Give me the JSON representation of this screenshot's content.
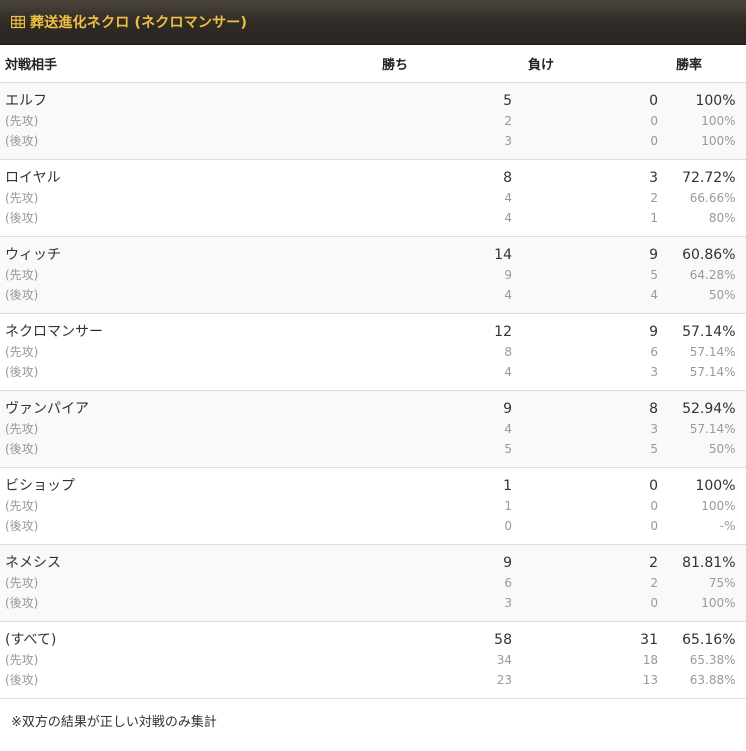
{
  "header": {
    "title": "葬送進化ネクロ (ネクロマンサー)",
    "icon": "table-grid-icon",
    "title_color": "#f0c040"
  },
  "columns": {
    "opponent": "対戦相手",
    "wins": "勝ち",
    "losses": "負け",
    "rate": "勝率"
  },
  "rows": [
    {
      "opponent": "エルフ",
      "wins": "5",
      "losses": "0",
      "rate": "100%",
      "first": {
        "label": "(先攻)",
        "wins": "2",
        "losses": "0",
        "rate": "100%"
      },
      "second": {
        "label": "(後攻)",
        "wins": "3",
        "losses": "0",
        "rate": "100%"
      }
    },
    {
      "opponent": "ロイヤル",
      "wins": "8",
      "losses": "3",
      "rate": "72.72%",
      "first": {
        "label": "(先攻)",
        "wins": "4",
        "losses": "2",
        "rate": "66.66%"
      },
      "second": {
        "label": "(後攻)",
        "wins": "4",
        "losses": "1",
        "rate": "80%"
      }
    },
    {
      "opponent": "ウィッチ",
      "wins": "14",
      "losses": "9",
      "rate": "60.86%",
      "first": {
        "label": "(先攻)",
        "wins": "9",
        "losses": "5",
        "rate": "64.28%"
      },
      "second": {
        "label": "(後攻)",
        "wins": "4",
        "losses": "4",
        "rate": "50%"
      }
    },
    {
      "opponent": "ネクロマンサー",
      "wins": "12",
      "losses": "9",
      "rate": "57.14%",
      "first": {
        "label": "(先攻)",
        "wins": "8",
        "losses": "6",
        "rate": "57.14%"
      },
      "second": {
        "label": "(後攻)",
        "wins": "4",
        "losses": "3",
        "rate": "57.14%"
      }
    },
    {
      "opponent": "ヴァンパイア",
      "wins": "9",
      "losses": "8",
      "rate": "52.94%",
      "first": {
        "label": "(先攻)",
        "wins": "4",
        "losses": "3",
        "rate": "57.14%"
      },
      "second": {
        "label": "(後攻)",
        "wins": "5",
        "losses": "5",
        "rate": "50%"
      }
    },
    {
      "opponent": "ビショップ",
      "wins": "1",
      "losses": "0",
      "rate": "100%",
      "first": {
        "label": "(先攻)",
        "wins": "1",
        "losses": "0",
        "rate": "100%"
      },
      "second": {
        "label": "(後攻)",
        "wins": "0",
        "losses": "0",
        "rate": "-%"
      }
    },
    {
      "opponent": "ネメシス",
      "wins": "9",
      "losses": "2",
      "rate": "81.81%",
      "first": {
        "label": "(先攻)",
        "wins": "6",
        "losses": "2",
        "rate": "75%"
      },
      "second": {
        "label": "(後攻)",
        "wins": "3",
        "losses": "0",
        "rate": "100%"
      }
    },
    {
      "opponent": "(すべて)",
      "wins": "58",
      "losses": "31",
      "rate": "65.16%",
      "first": {
        "label": "(先攻)",
        "wins": "34",
        "losses": "18",
        "rate": "65.38%"
      },
      "second": {
        "label": "(後攻)",
        "wins": "23",
        "losses": "13",
        "rate": "63.88%"
      }
    }
  ],
  "footnote": "※双方の結果が正しい対戦のみ集計"
}
